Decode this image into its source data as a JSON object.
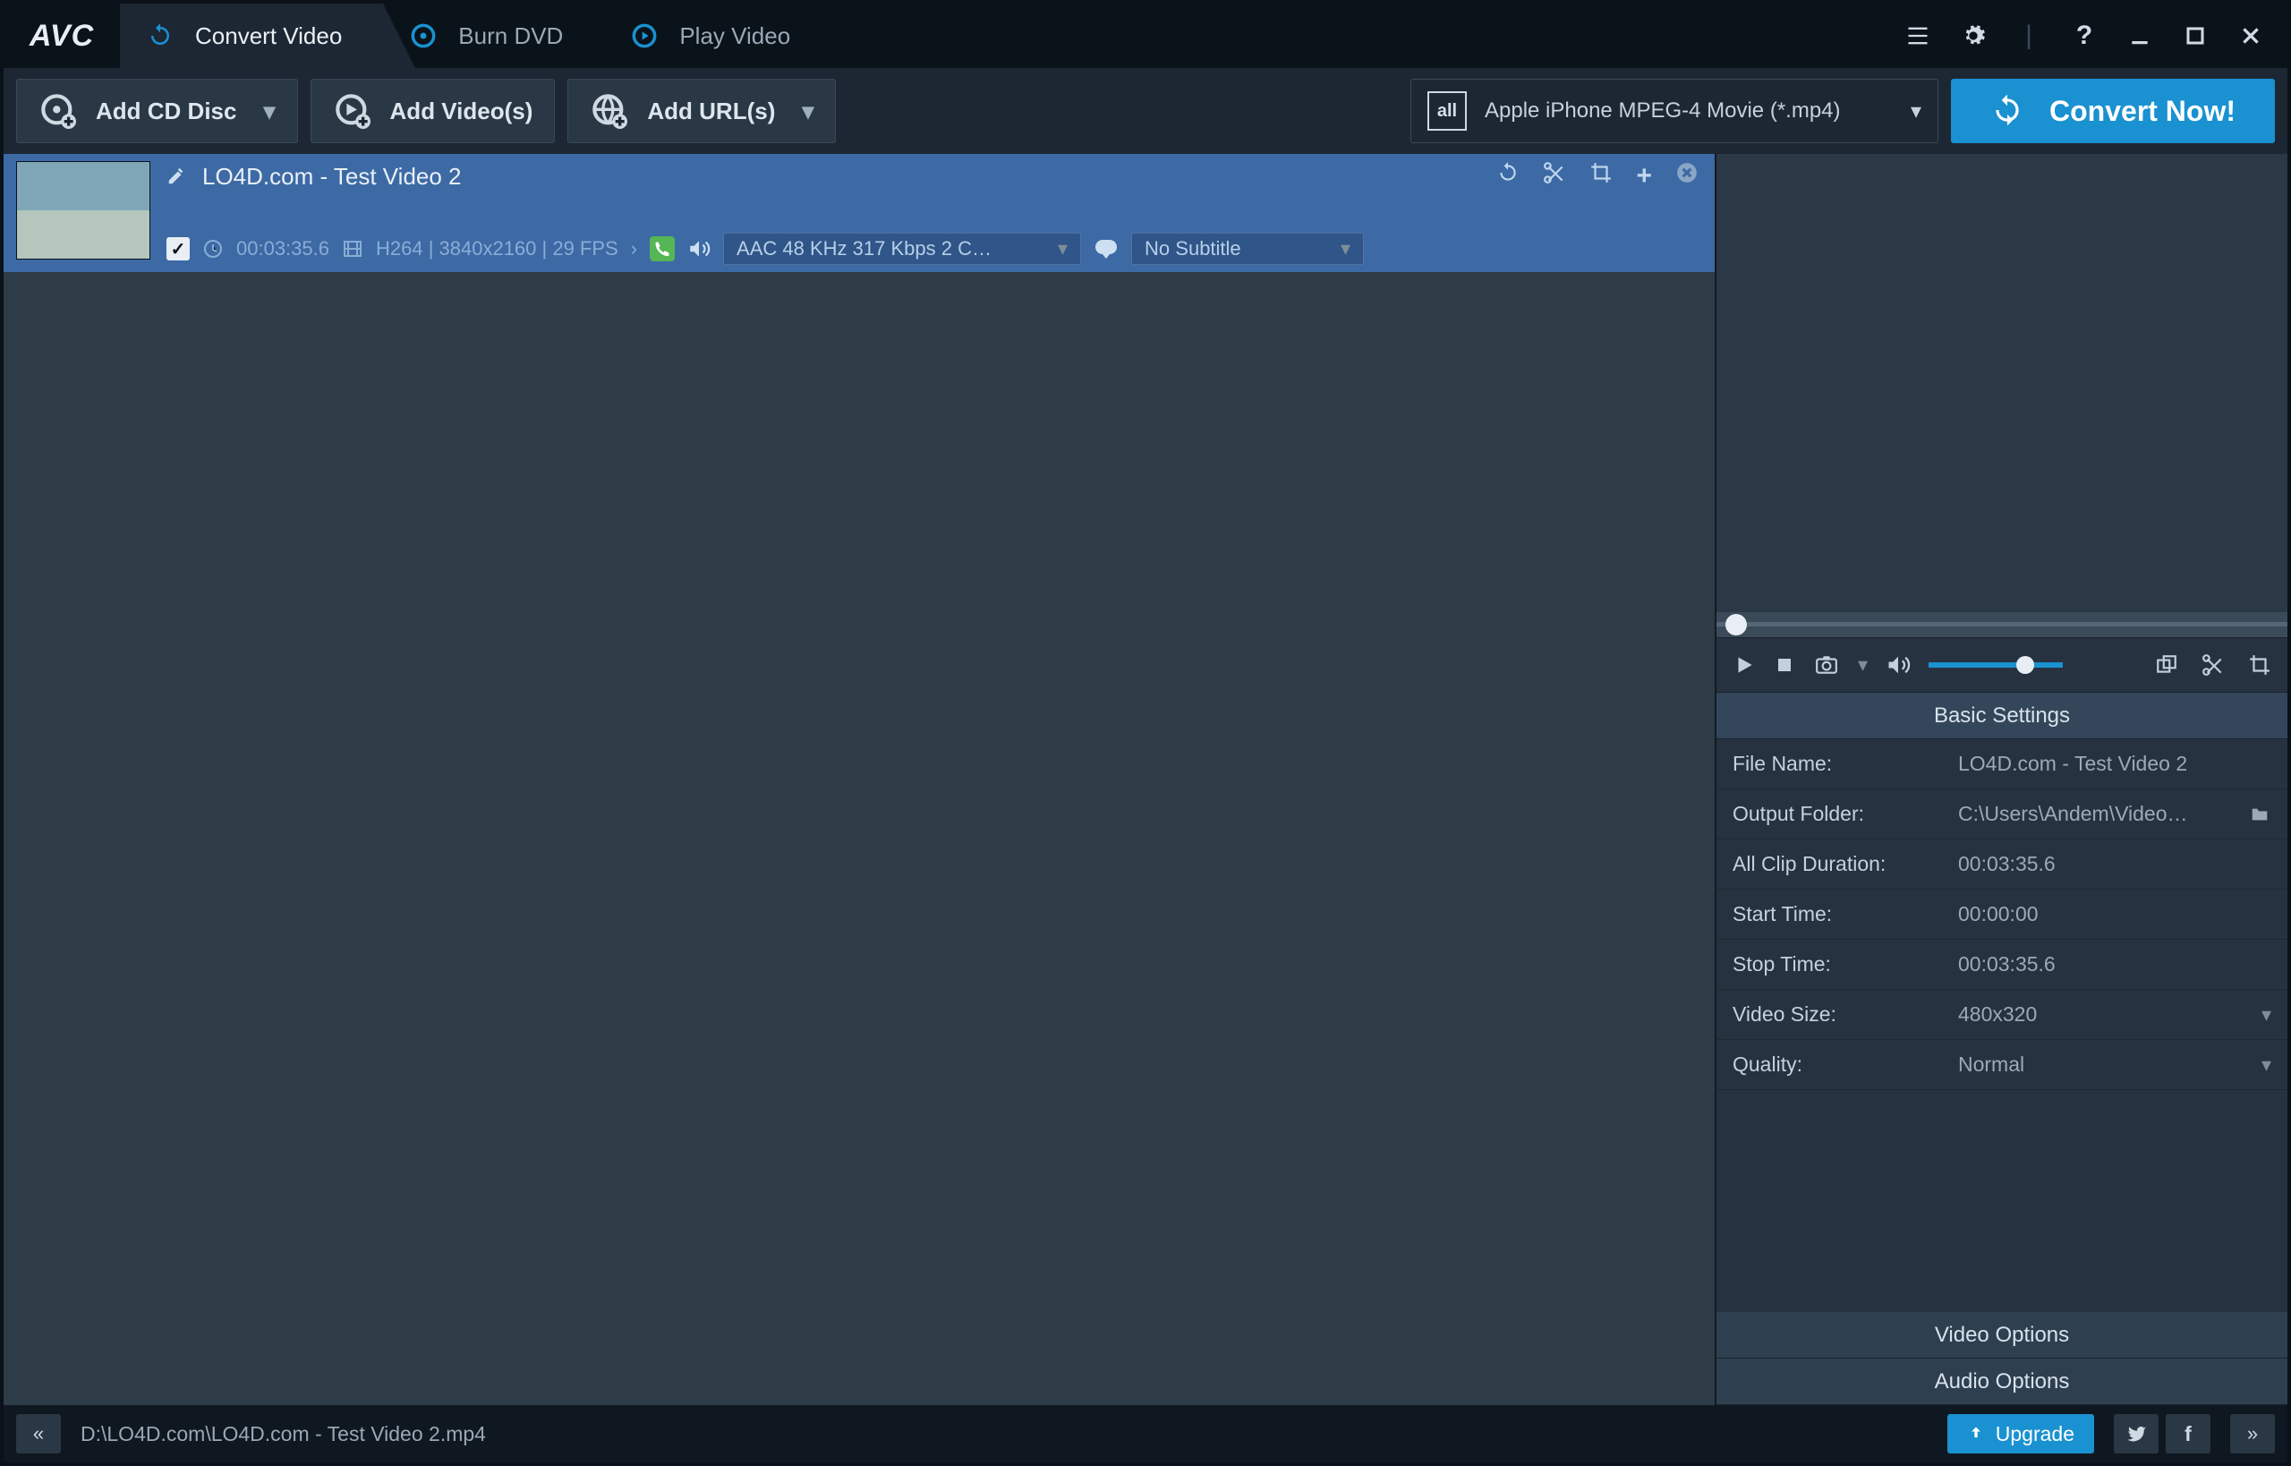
{
  "logo": "AVC",
  "tabs": [
    {
      "label": "Convert Video",
      "active": true
    },
    {
      "label": "Burn DVD",
      "active": false
    },
    {
      "label": "Play Video",
      "active": false
    }
  ],
  "toolbar": {
    "add_disc": "Add CD Disc",
    "add_videos": "Add Video(s)",
    "add_urls": "Add URL(s)",
    "profile": "Apple iPhone MPEG-4 Movie (*.mp4)",
    "profile_badge": "all",
    "convert": "Convert Now!"
  },
  "item": {
    "title": "LO4D.com - Test Video 2",
    "duration": "00:03:35.6",
    "video_info": "H264 | 3840x2160 | 29 FPS",
    "audio": "AAC 48 KHz 317 Kbps 2 C…",
    "subtitle": "No Subtitle"
  },
  "player": {
    "basic_settings_title": "Basic Settings",
    "rows": {
      "file_name_lab": "File Name:",
      "file_name_val": "LO4D.com - Test Video 2",
      "output_lab": "Output Folder:",
      "output_val": "C:\\Users\\Andem\\Video…",
      "all_dur_lab": "All Clip Duration:",
      "all_dur_val": "00:03:35.6",
      "start_lab": "Start Time:",
      "start_val": "00:00:00",
      "stop_lab": "Stop Time:",
      "stop_val": "00:03:35.6",
      "vsize_lab": "Video Size:",
      "vsize_val": "480x320",
      "quality_lab": "Quality:",
      "quality_val": "Normal"
    },
    "video_options": "Video Options",
    "audio_options": "Audio Options"
  },
  "status": {
    "path": "D:\\LO4D.com\\LO4D.com - Test Video 2.mp4",
    "upgrade": "Upgrade"
  }
}
